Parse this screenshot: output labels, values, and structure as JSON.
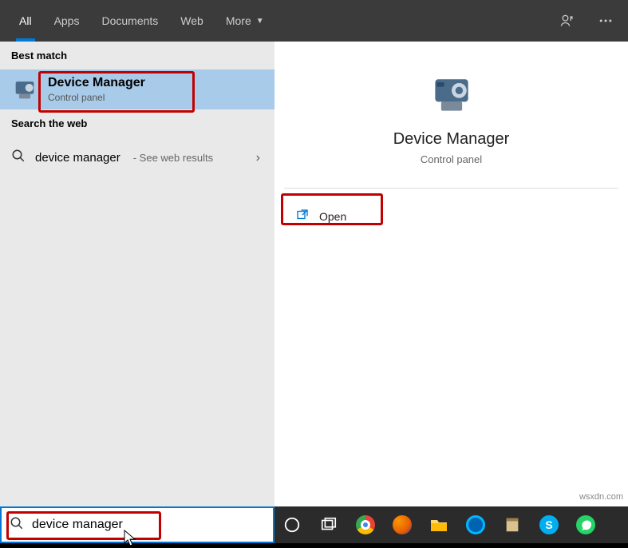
{
  "tabs": {
    "all": "All",
    "apps": "Apps",
    "documents": "Documents",
    "web": "Web",
    "more": "More"
  },
  "sections": {
    "best_match": "Best match",
    "search_web": "Search the web"
  },
  "result": {
    "title": "Device Manager",
    "subtitle": "Control panel"
  },
  "web": {
    "query": "device manager",
    "hint": "- See web results"
  },
  "preview": {
    "title": "Device Manager",
    "subtitle": "Control panel"
  },
  "actions": {
    "open": "Open"
  },
  "search": {
    "value": "device manager"
  },
  "taskbar": {
    "items": [
      "cortana",
      "task-view",
      "chrome",
      "firefox",
      "explorer",
      "groove",
      "onenote",
      "skype",
      "whatsapp"
    ]
  },
  "watermark": "wsxdn.com"
}
